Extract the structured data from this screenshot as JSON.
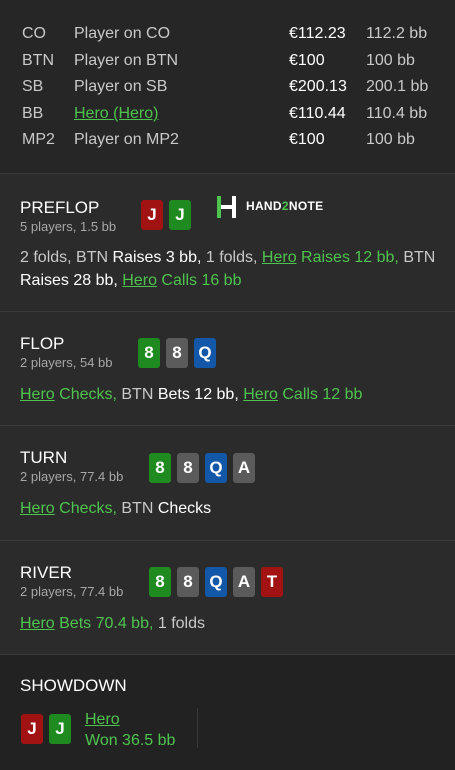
{
  "seats": [
    {
      "pos": "CO",
      "name": "Player on CO",
      "stack": "€112.23",
      "bb": "112.2 bb",
      "hero": false
    },
    {
      "pos": "BTN",
      "name": "Player on BTN",
      "stack": "€100",
      "bb": "100 bb",
      "hero": false
    },
    {
      "pos": "SB",
      "name": "Player on SB",
      "stack": "€200.13",
      "bb": "200.1 bb",
      "hero": false
    },
    {
      "pos": "BB",
      "name": "Hero (Hero)",
      "stack": "€110.44",
      "bb": "110.4 bb",
      "hero": true
    },
    {
      "pos": "MP2",
      "name": "Player on MP2",
      "stack": "€100",
      "bb": "100 bb",
      "hero": false
    }
  ],
  "logo": {
    "prefix": "HAND",
    "two": "2",
    "suffix": "NOTE"
  },
  "preflop": {
    "title": "PREFLOP",
    "sub": "5 players, 1.5 bb",
    "cards": [
      "J",
      "J"
    ],
    "a1": "2 folds, BTN ",
    "a2": "Raises 3 bb,",
    "a3": " 1 folds, ",
    "a4": "Hero",
    "a5": " Raises 12 bb,",
    "a6": " BTN",
    "a7": "Raises 28 bb,",
    "a8": " ",
    "a9": "Hero",
    "a10": " Calls 16 bb"
  },
  "flop": {
    "title": "FLOP",
    "sub": "2 players, 54 bb",
    "cards": [
      "8",
      "8",
      "Q"
    ],
    "a1": "Hero",
    "a2": " Checks,",
    "a3": " BTN ",
    "a4": "Bets 12 bb,",
    "a5": " ",
    "a6": "Hero",
    "a7": " Calls 12 bb"
  },
  "turn": {
    "title": "TURN",
    "sub": "2 players, 77.4 bb",
    "cards": [
      "8",
      "8",
      "Q",
      "A"
    ],
    "a1": "Hero",
    "a2": " Checks,",
    "a3": " BTN ",
    "a4": "Checks"
  },
  "river": {
    "title": "RIVER",
    "sub": "2 players, 77.4 bb",
    "cards": [
      "8",
      "8",
      "Q",
      "A",
      "T"
    ],
    "a1": "Hero",
    "a2": " Bets 70.4 bb,",
    "a3": " 1 folds"
  },
  "showdown": {
    "title": "SHOWDOWN",
    "cards": [
      "J",
      "J"
    ],
    "player": "Hero",
    "result": "Won 36.5 bb"
  },
  "colors": {
    "hero_green": "#4ec44e",
    "card_red": "#a11212",
    "card_green": "#1f8a1f",
    "card_gray": "#5b5b5b",
    "card_blue": "#1257a8"
  }
}
